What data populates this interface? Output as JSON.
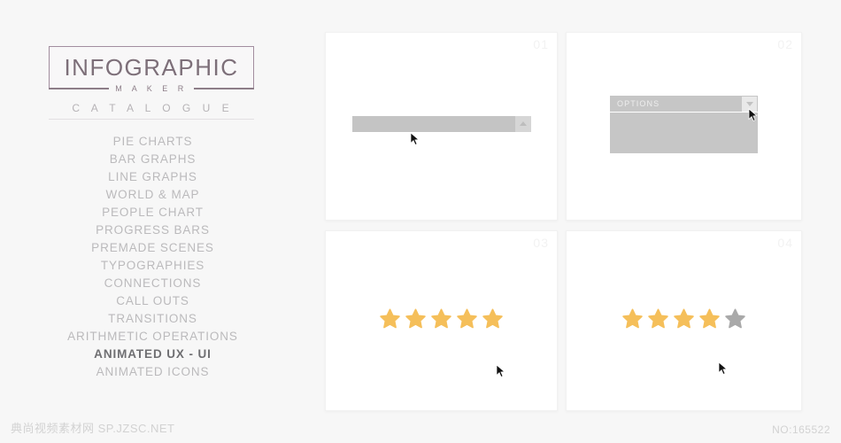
{
  "watermarks": {
    "left": "典尚视频素材网 SP.JZSC.NET",
    "right": "NO:165522"
  },
  "sidebar": {
    "logo": {
      "title": "INFOGRAPHIC",
      "subtitle": "M A K E R"
    },
    "section_label": "C A T A L O G U E",
    "items": [
      {
        "label": "PIE CHARTS",
        "active": false
      },
      {
        "label": "BAR GRAPHS",
        "active": false
      },
      {
        "label": "LINE GRAPHS",
        "active": false
      },
      {
        "label": "WORLD & MAP",
        "active": false
      },
      {
        "label": "PEOPLE CHART",
        "active": false
      },
      {
        "label": "PROGRESS BARS",
        "active": false
      },
      {
        "label": "PREMADE SCENES",
        "active": false
      },
      {
        "label": "TYPOGRAPHIES",
        "active": false
      },
      {
        "label": "CONNECTIONS",
        "active": false
      },
      {
        "label": "CALL OUTS",
        "active": false
      },
      {
        "label": "TRANSITIONS",
        "active": false
      },
      {
        "label": "ARITHMETIC OPERATIONS",
        "active": false
      },
      {
        "label": "ANIMATED UX - UI",
        "active": true
      },
      {
        "label": "ANIMATED ICONS",
        "active": false
      }
    ]
  },
  "panels": [
    {
      "number": "01",
      "kind": "select-collapsed",
      "select_value": "",
      "button_icon": "caret-up-icon",
      "cursor": "arrow-cursor"
    },
    {
      "number": "02",
      "kind": "select-expanded",
      "dropdown_label": "OPTIONS",
      "button_icon": "caret-down-icon",
      "cursor": "arrow-cursor"
    },
    {
      "number": "03",
      "kind": "star-rating",
      "rating": 5,
      "max": 5,
      "cursor": "arrow-cursor"
    },
    {
      "number": "04",
      "kind": "star-rating",
      "rating": 4,
      "max": 5,
      "cursor": "arrow-cursor"
    }
  ],
  "colors": {
    "background": "#f7f7f7",
    "panel": "#ffffff",
    "logo_border": "#a28e9f",
    "logo_text": "#7d6f79",
    "menu_text": "#bbbabc",
    "menu_active_text": "#6f6f72",
    "menu_active_bg": "#fdfdfd",
    "control_gray": "#c4c4c4",
    "control_btn": "#e9e9e9",
    "star_filled": "#f5bf5a",
    "star_empty": "#a9a9a9",
    "panel_number": "#f2f2f2"
  }
}
